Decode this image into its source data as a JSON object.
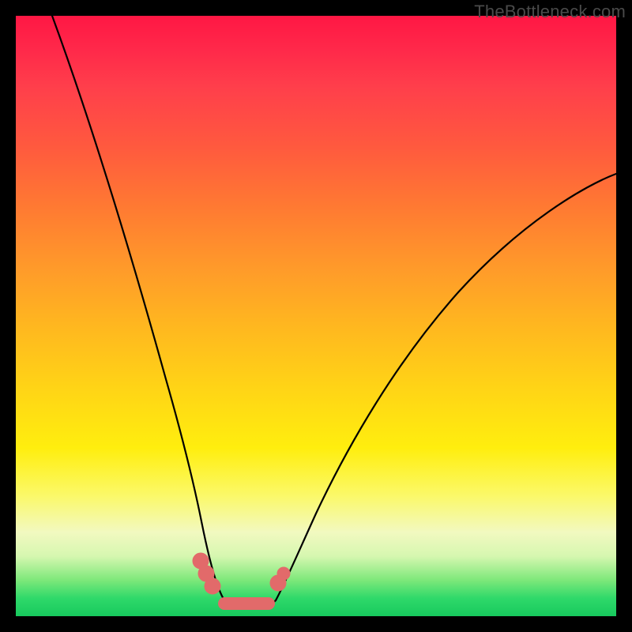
{
  "watermark": "TheBottleneck.com",
  "colors": {
    "marker": "#e26a6a",
    "curve": "#000000",
    "gradient_top": "#ff1744",
    "gradient_bottom": "#17c95d"
  },
  "chart_data": {
    "type": "line",
    "title": "",
    "xlabel": "",
    "ylabel": "",
    "xlim": [
      0,
      100
    ],
    "ylim": [
      0,
      100
    ],
    "grid": false,
    "legend": false,
    "note": "Values are approximate pixel-normalized percentages read from the figure; y=0 is the bottom (green) and y=100 is the top (red). The curve is a V-shaped bottleneck profile with a flat minimum near x≈34–42.",
    "series": [
      {
        "name": "left-branch",
        "x": [
          6,
          10,
          14,
          18,
          22,
          25,
          27,
          29,
          30,
          31,
          32,
          33,
          34
        ],
        "y": [
          100,
          84,
          68,
          52,
          37,
          26,
          19,
          13,
          10,
          8,
          6,
          5,
          3
        ]
      },
      {
        "name": "valley-floor",
        "x": [
          34,
          36,
          38,
          40,
          42
        ],
        "y": [
          3,
          2.5,
          2.5,
          2.5,
          3
        ]
      },
      {
        "name": "right-branch",
        "x": [
          42,
          44,
          46,
          50,
          56,
          64,
          74,
          86,
          100
        ],
        "y": [
          3,
          6,
          10,
          18,
          28,
          40,
          52,
          62,
          71
        ]
      }
    ],
    "markers": {
      "description": "Salmon-colored circular clusters near the bottom of each branch and a rounded bar across the valley floor.",
      "color": "#e26a6a",
      "points": [
        {
          "x": 30.5,
          "y": 9,
          "r": 1.4
        },
        {
          "x": 31.5,
          "y": 7,
          "r": 1.4
        },
        {
          "x": 32.5,
          "y": 5.5,
          "r": 1.4
        },
        {
          "x": 43.0,
          "y": 6.0,
          "r": 1.4
        },
        {
          "x": 43.8,
          "y": 7.5,
          "r": 1.2
        }
      ],
      "floor_bar": {
        "x0": 33.5,
        "x1": 42.5,
        "y": 2.8,
        "thickness": 2.2
      }
    }
  }
}
